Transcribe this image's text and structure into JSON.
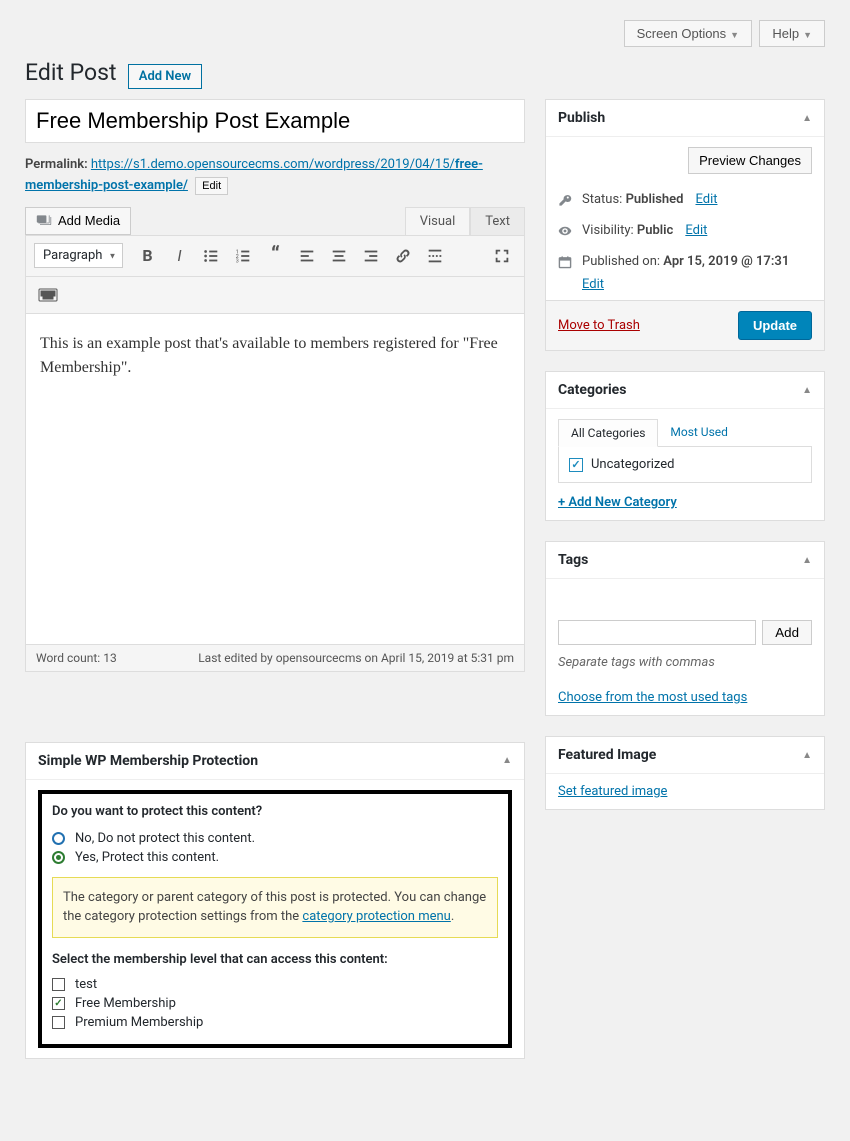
{
  "topActions": {
    "screenOptions": "Screen Options",
    "help": "Help"
  },
  "header": {
    "title": "Edit Post",
    "addNew": "Add New"
  },
  "post": {
    "title": "Free Membership Post Example",
    "permalinkLabel": "Permalink:",
    "permalinkBase": "https://s1.demo.opensourcecms.com/wordpress/2019/04/15/",
    "permalinkSlug": "free-membership-post-example/",
    "editLabel": "Edit",
    "addMedia": "Add Media",
    "tabs": {
      "visual": "Visual",
      "text": "Text"
    },
    "formatSelect": "Paragraph",
    "content": "This is an example post that's available to members registered for \"Free Membership\".",
    "wordCountLabel": "Word count:",
    "wordCount": "13",
    "lastEdited": "Last edited by opensourcecms on April 15, 2019 at 5:31 pm"
  },
  "publish": {
    "title": "Publish",
    "preview": "Preview Changes",
    "statusLabel": "Status:",
    "status": "Published",
    "visibilityLabel": "Visibility:",
    "visibility": "Public",
    "publishedLabel": "Published on:",
    "publishedDate": "Apr 15, 2019 @ 17:31",
    "edit": "Edit",
    "trash": "Move to Trash",
    "update": "Update"
  },
  "categories": {
    "title": "Categories",
    "tabAll": "All Categories",
    "tabMost": "Most Used",
    "items": [
      {
        "label": "Uncategorized",
        "checked": true
      }
    ],
    "addNew": "+ Add New Category"
  },
  "tags": {
    "title": "Tags",
    "add": "Add",
    "hint": "Separate tags with commas",
    "choose": "Choose from the most used tags"
  },
  "featuredImage": {
    "title": "Featured Image",
    "set": "Set featured image"
  },
  "swpm": {
    "title": "Simple WP Membership Protection",
    "question": "Do you want to protect this content?",
    "optNo": "No, Do not protect this content.",
    "optYes": "Yes, Protect this content.",
    "noticeA": "The category or parent category of this post is protected. You can change the category protection settings from the ",
    "noticeLink": "category protection menu",
    "question2": "Select the membership level that can access this content:",
    "levels": [
      {
        "label": "test",
        "checked": false
      },
      {
        "label": "Free Membership",
        "checked": true
      },
      {
        "label": "Premium Membership",
        "checked": false
      }
    ]
  }
}
